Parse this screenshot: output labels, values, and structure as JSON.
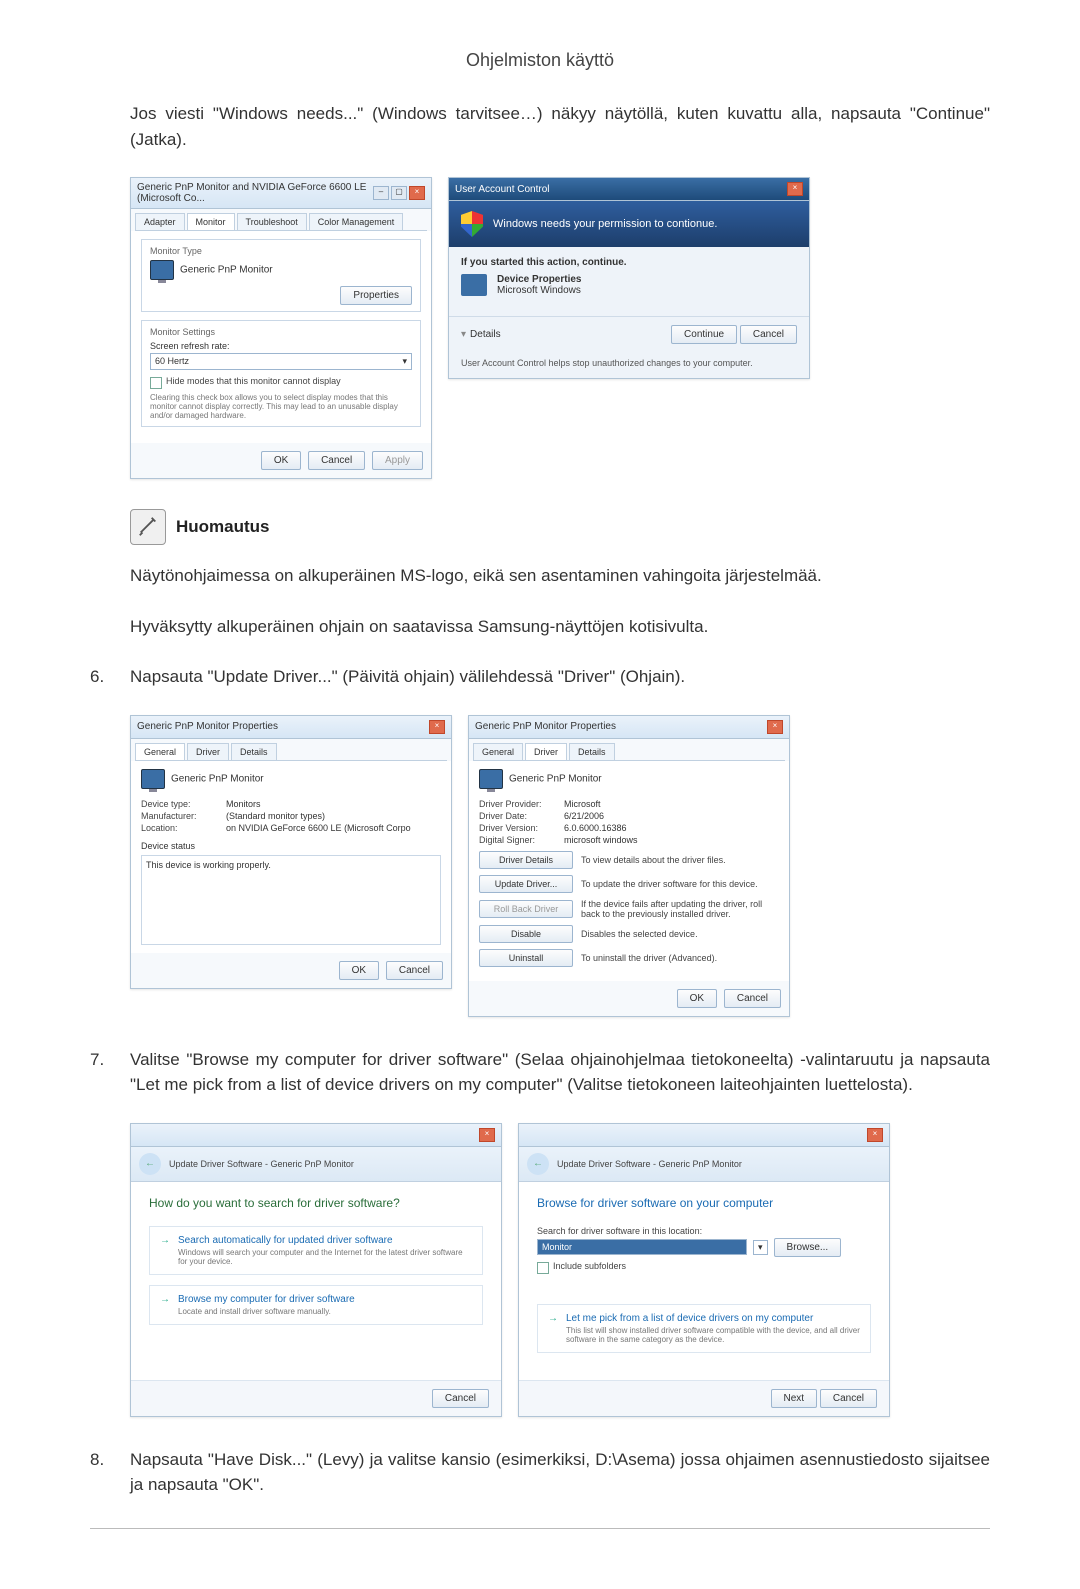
{
  "page_title": "Ohjelmiston käyttö",
  "intro_paragraph": "Jos viesti \"Windows needs...\" (Windows tarvitsee…) näkyy näytöllä, kuten kuvattu alla, napsauta \"Continue\" (Jatka).",
  "dlg_display": {
    "title": "Generic PnP Monitor and NVIDIA GeForce 6600 LE (Microsoft Co...",
    "tabs": {
      "adapter": "Adapter",
      "monitor": "Monitor",
      "troubleshoot": "Troubleshoot",
      "color": "Color Management"
    },
    "monitor_type_legend": "Monitor Type",
    "monitor_type_value": "Generic PnP Monitor",
    "properties_btn": "Properties",
    "monitor_settings_legend": "Monitor Settings",
    "refresh_label": "Screen refresh rate:",
    "refresh_value": "60 Hertz",
    "hide_modes_checkbox": "Hide modes that this monitor cannot display",
    "hide_modes_note": "Clearing this check box allows you to select display modes that this monitor cannot display correctly. This may lead to an unusable display and/or damaged hardware.",
    "ok": "OK",
    "cancel": "Cancel",
    "apply": "Apply"
  },
  "dlg_uac": {
    "title": "User Account Control",
    "headline": "Windows needs your permission to contionue.",
    "if_started": "If you started this action, continue.",
    "app_line1": "Device Properties",
    "app_line2": "Microsoft Windows",
    "details": "Details",
    "continue": "Continue",
    "cancel": "Cancel",
    "footnote": "User Account Control helps stop unauthorized changes to your computer."
  },
  "note": {
    "heading": "Huomautus",
    "p1": "Näytönohjaimessa on alkuperäinen MS-logo, eikä sen asentaminen vahingoita järjestelmää.",
    "p2": "Hyväksytty alkuperäinen ohjain on saatavissa Samsung-näyttöjen kotisivulta."
  },
  "step6_num": "6.",
  "step6": "Napsauta \"Update Driver...\" (Päivitä ohjain) välilehdessä \"Driver\" (Ohjain).",
  "dlg_props_general": {
    "title": "Generic PnP Monitor Properties",
    "tabs": {
      "general": "General",
      "driver": "Driver",
      "details": "Details"
    },
    "name": "Generic PnP Monitor",
    "device_type_k": "Device type:",
    "device_type_v": "Monitors",
    "manufacturer_k": "Manufacturer:",
    "manufacturer_v": "(Standard monitor types)",
    "location_k": "Location:",
    "location_v": "on NVIDIA GeForce 6600 LE (Microsoft Corpo",
    "device_status_label": "Device status",
    "device_status_text": "This device is working properly.",
    "ok": "OK",
    "cancel": "Cancel"
  },
  "dlg_props_driver": {
    "title": "Generic PnP Monitor Properties",
    "tabs": {
      "general": "General",
      "driver": "Driver",
      "details": "Details"
    },
    "name": "Generic PnP Monitor",
    "provider_k": "Driver Provider:",
    "provider_v": "Microsoft",
    "date_k": "Driver Date:",
    "date_v": "6/21/2006",
    "version_k": "Driver Version:",
    "version_v": "6.0.6000.16386",
    "signer_k": "Digital Signer:",
    "signer_v": "microsoft windows",
    "btn_details": "Driver Details",
    "btn_details_desc": "To view details about the driver files.",
    "btn_update": "Update Driver...",
    "btn_update_desc": "To update the driver software for this device.",
    "btn_rollback": "Roll Back Driver",
    "btn_rollback_desc": "If the device fails after updating the driver, roll back to the previously installed driver.",
    "btn_disable": "Disable",
    "btn_disable_desc": "Disables the selected device.",
    "btn_uninstall": "Uninstall",
    "btn_uninstall_desc": "To uninstall the driver (Advanced).",
    "ok": "OK",
    "cancel": "Cancel"
  },
  "step7_num": "7.",
  "step7": "Valitse \"Browse my computer for driver software\" (Selaa ohjainohjelmaa tietokoneelta) -valintaruutu ja napsauta \"Let me pick from a list of device drivers on my computer\" (Valitse tietokoneen laiteohjainten luettelosta).",
  "dlg_wiz1": {
    "title": "Update Driver Software - Generic PnP Monitor",
    "question": "How do you want to search for driver software?",
    "opt1_title": "Search automatically for updated driver software",
    "opt1_desc": "Windows will search your computer and the Internet for the latest driver software for your device.",
    "opt2_title": "Browse my computer for driver software",
    "opt2_desc": "Locate and install driver software manually.",
    "cancel": "Cancel"
  },
  "dlg_wiz2": {
    "title": "Update Driver Software - Generic PnP Monitor",
    "heading": "Browse for driver software on your computer",
    "search_label": "Search for driver software in this location:",
    "path_value": "Monitor",
    "browse_btn": "Browse...",
    "include_sub": "Include subfolders",
    "opt_title": "Let me pick from a list of device drivers on my computer",
    "opt_desc": "This list will show installed driver software compatible with the device, and all driver software in the same category as the device.",
    "next": "Next",
    "cancel": "Cancel"
  },
  "step8_num": "8.",
  "step8": "Napsauta \"Have Disk...\" (Levy) ja valitse kansio (esimerkiksi, D:\\Asema) jossa ohjaimen asennustiedosto sijaitsee ja napsauta \"OK\"."
}
